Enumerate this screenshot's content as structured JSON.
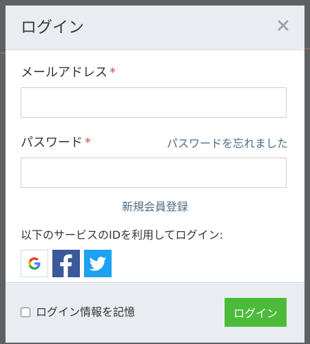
{
  "dialog": {
    "title": "ログイン",
    "close_label": "×"
  },
  "email": {
    "label": "メールアドレス",
    "required_mark": "*",
    "value": "",
    "placeholder": ""
  },
  "password": {
    "label": "パスワード",
    "required_mark": "*",
    "value": "",
    "placeholder": "",
    "forgot_link": "パスワードを忘れました"
  },
  "register_link": "新規会員登録",
  "sso": {
    "heading": "以下のサービスのIDを利用してログイン:",
    "providers": [
      {
        "name": "Google",
        "icon": "google-icon",
        "color": "#ffffff"
      },
      {
        "name": "Facebook",
        "icon": "facebook-icon",
        "color": "#3b5998"
      },
      {
        "name": "Twitter",
        "icon": "twitter-icon",
        "color": "#1da1f2"
      }
    ]
  },
  "footer": {
    "remember_label": "ログイン情報を記憶",
    "remember_checked": false,
    "login_button": "ログイン"
  },
  "colors": {
    "header_bg": "#e9edf1",
    "link": "#4d6b85",
    "required": "#e04a4a",
    "login_button": "#4dbb3a"
  }
}
